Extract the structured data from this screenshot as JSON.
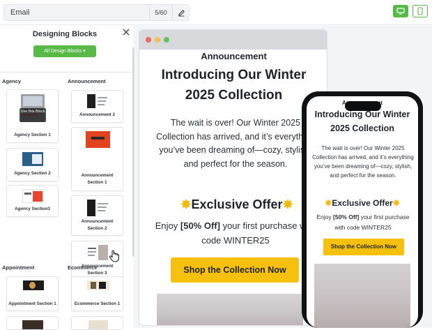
{
  "topbar": {
    "email_name": "Email",
    "char_count": "5/60",
    "edit_icon": "pencil-icon",
    "desktop_icon": "monitor-icon",
    "mobile_icon": "smartphone-icon",
    "accent": "#58b947"
  },
  "sidebar": {
    "title": "Designing Blocks",
    "filter_label": "All Design Blocks",
    "close_icon": "close-icon",
    "categories": {
      "agency": "Agency",
      "announcement": "Announcement",
      "appointment": "Appointment",
      "ecommerce": "Ecommerce"
    },
    "hover_label": "Use this Block",
    "cards": {
      "agency1": "Agency Section 1",
      "agency2": "Agency Section 2",
      "agency3": "Agency Section3",
      "ann2": "Announcement 2",
      "ann_s1": "Announcement Section 1",
      "ann_s2": "Announcement Section 2",
      "ann_s3": "Announcement Section 3",
      "appt1": "Appointment Section 1",
      "ecom1": "Ecommerce Section 1"
    }
  },
  "email": {
    "announcement": "Announcement",
    "headline": "Introducing Our Winter 2025 Collection",
    "body": "The wait is over! Our Winter 2025 Collection has arrived, and it’s everything you’ve been dreaming of—cozy, stylish, and perfect for the season.",
    "offer_title": "Exclusive Offer",
    "offer_icon": "sparkle-icon",
    "enjoy_prefix": "Enjoy ",
    "enjoy_bold": "[50% Off]",
    "enjoy_suffix": " your first purchase with code WINTER25",
    "cta": "Shop the Collection Now",
    "cta_color": "#f6c00e"
  }
}
